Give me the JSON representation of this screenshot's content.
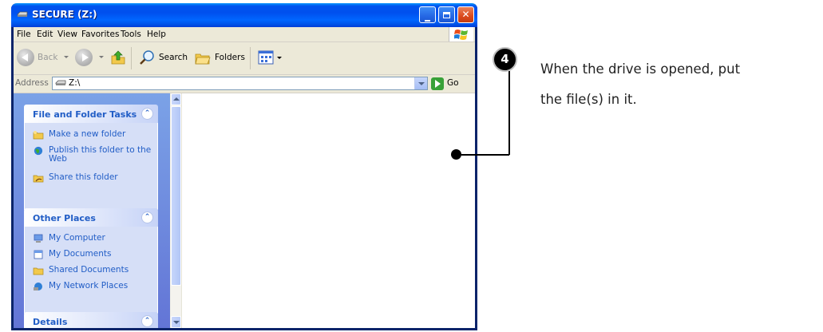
{
  "window": {
    "title": "SECURE (Z:)",
    "menu": [
      "File",
      "Edit",
      "View",
      "Favorites",
      "Tools",
      "Help"
    ],
    "toolbar": {
      "back_label": "Back",
      "search_label": "Search",
      "folders_label": "Folders"
    },
    "address": {
      "label": "Address",
      "value": "Z:\\",
      "go_label": "Go"
    }
  },
  "taskpane": {
    "file_tasks": {
      "title": "File and Folder Tasks",
      "items": [
        "Make a new folder",
        "Publish this folder to the Web",
        "Share this folder"
      ]
    },
    "other_places": {
      "title": "Other Places",
      "items": [
        "My Computer",
        "My Documents",
        "Shared Documents",
        "My Network Places"
      ]
    },
    "details": {
      "title": "Details"
    }
  },
  "callout": {
    "step": "4",
    "line1": "When the drive is opened, put",
    "line2": "the file(s) in it."
  },
  "colors": {
    "titlebar": "#0053ee",
    "taskpane": "#6f8ee0",
    "link": "#215dc6"
  }
}
